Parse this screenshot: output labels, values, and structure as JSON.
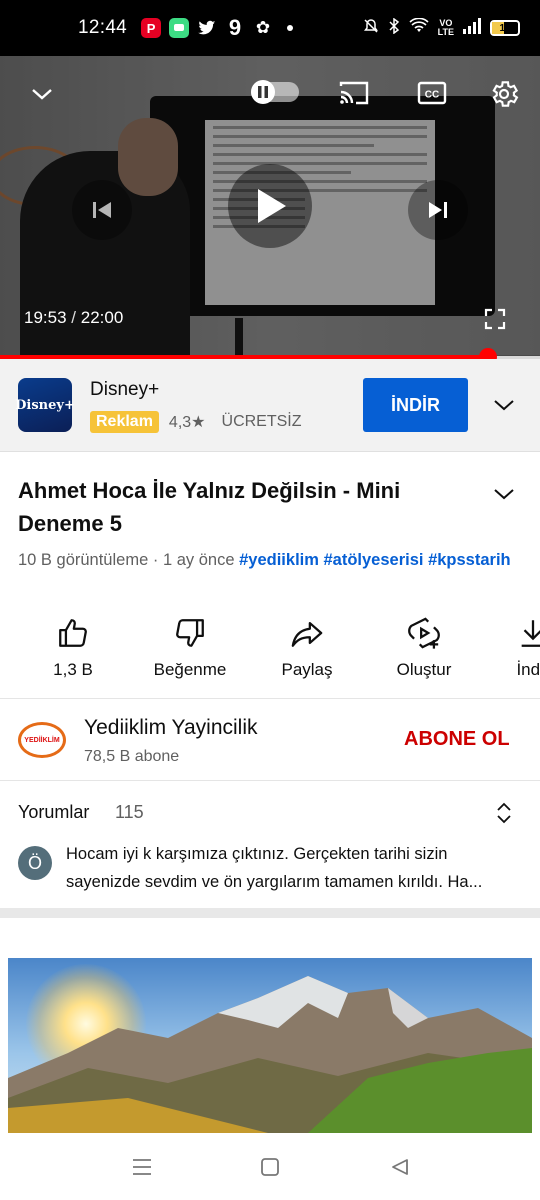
{
  "status_bar": {
    "time": "12:44",
    "apps": [
      {
        "icon": "pinterest-icon",
        "glyph": "P",
        "bg": "#e60023"
      },
      {
        "icon": "messages-icon",
        "glyph": "",
        "bg": "#3ddc84"
      },
      {
        "icon": "twitter-icon",
        "glyph": "🐦",
        "bg": "transparent"
      },
      {
        "icon": "nine-app-icon",
        "glyph": "9",
        "bg": "transparent"
      },
      {
        "icon": "pinwheel-icon",
        "glyph": "✿",
        "bg": "transparent"
      }
    ],
    "network": "VoLTE",
    "battery": "16"
  },
  "player": {
    "current_time": "19:53",
    "separator": "/",
    "duration": "22:00",
    "progress_fraction": 0.9045
  },
  "ad": {
    "app_name": "Disney+",
    "logo_text": "Disney+",
    "badge": "Reklam",
    "rating": "4,3",
    "price": "ÜCRETSİZ",
    "button_label": "İNDİR"
  },
  "video": {
    "title": "Ahmet Hoca İle Yalnız Değilsin - Mini Deneme 5",
    "views": "10 B görüntüleme",
    "dot": "·",
    "age": "1 ay önce",
    "tags": [
      "#yediiklim",
      "#atölyeserisi",
      "#kpsstarih"
    ]
  },
  "actions": {
    "like": "1,3 B",
    "dislike": "Beğenme",
    "share": "Paylaş",
    "create": "Oluştur",
    "download": "İndir"
  },
  "channel": {
    "name": "Yediiklim Yayincilik",
    "subscribers": "78,5 B abone",
    "logo_text": "YEDİİKLİM",
    "subscribe_label": "ABONE OL"
  },
  "comments": {
    "label": "Yorumlar",
    "count": "115",
    "avatar_letter": "Ö",
    "top_comment": "Hocam iyi k karşımıza çıktınız. Gerçekten tarihi sizin sayenizde sevdim ve ön yargılarım tamamen kırıldı. Ha..."
  },
  "colors": {
    "accent_blue": "#065fd4",
    "progress_red": "#ff0000",
    "subscribe_red": "#cc0000",
    "ad_badge": "#f6c338"
  }
}
